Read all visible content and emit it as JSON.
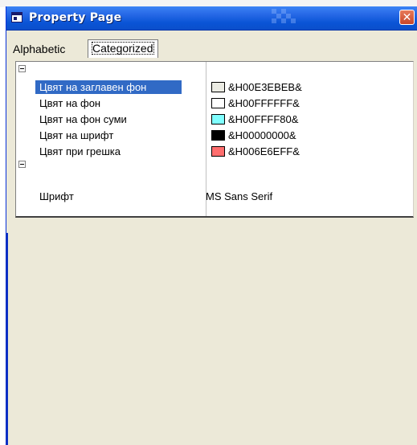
{
  "window": {
    "title": "Property Page",
    "close_glyph": "✕"
  },
  "tabs": [
    {
      "label": "Alphabetic",
      "selected": false
    },
    {
      "label": "Categorized",
      "selected": true
    }
  ],
  "grid": {
    "rows": [
      {
        "name": "Цвят на заглавен фон",
        "value": "&H00E3EBEB&",
        "swatch": "#ebebe3",
        "selected": true
      },
      {
        "name": "Цвят на фон",
        "value": "&H00FFFFFF&",
        "swatch": "#ffffff",
        "selected": false
      },
      {
        "name": "Цвят на фон суми",
        "value": "&H00FFFF80&",
        "swatch": "#80ffff",
        "selected": false
      },
      {
        "name": "Цвят на шрифт",
        "value": "&H00000000&",
        "swatch": "#000000",
        "selected": false
      },
      {
        "name": "Цвят при грешка",
        "value": "&H006E6EFF&",
        "swatch": "#ff6e6e",
        "selected": false
      }
    ],
    "font_row": {
      "name": "Шрифт",
      "value": "MS Sans Serif"
    }
  },
  "colors": {
    "title_bar": "#0a54d6",
    "selection": "#316ac5",
    "window_bg": "#ece9d8"
  },
  "icons": {
    "app": "property-page-icon",
    "close": "close-icon",
    "collapse": "collapse-icon"
  }
}
